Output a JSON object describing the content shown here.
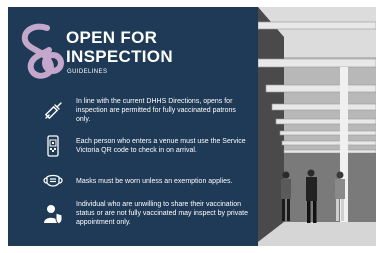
{
  "card": {
    "title_line1": "OPEN FOR",
    "title_line2": "INSPECTION",
    "subtitle": "GUIDELINES",
    "colors": {
      "panel": "#1f3a56",
      "logo": "#c4a8cc",
      "text": "#ffffff"
    }
  },
  "items": [
    {
      "icon": "syringe-icon",
      "text": "In line with the current DHHS Directions, opens for inspection are permitted for fully vaccinated patrons only."
    },
    {
      "icon": "qr-code-phone-icon",
      "text": "Each person who enters a venue must use the Service Victoria QR code to check in on arrival."
    },
    {
      "icon": "face-mask-icon",
      "text": "Masks must be worn unless an exemption applies."
    },
    {
      "icon": "person-shield-icon",
      "text": "Individual who are unwilling to share their vaccination status or are not fully vaccinated may inspect by private appointment only."
    }
  ],
  "photo": {
    "subject": "house-entrance-with-visitors-photo"
  }
}
